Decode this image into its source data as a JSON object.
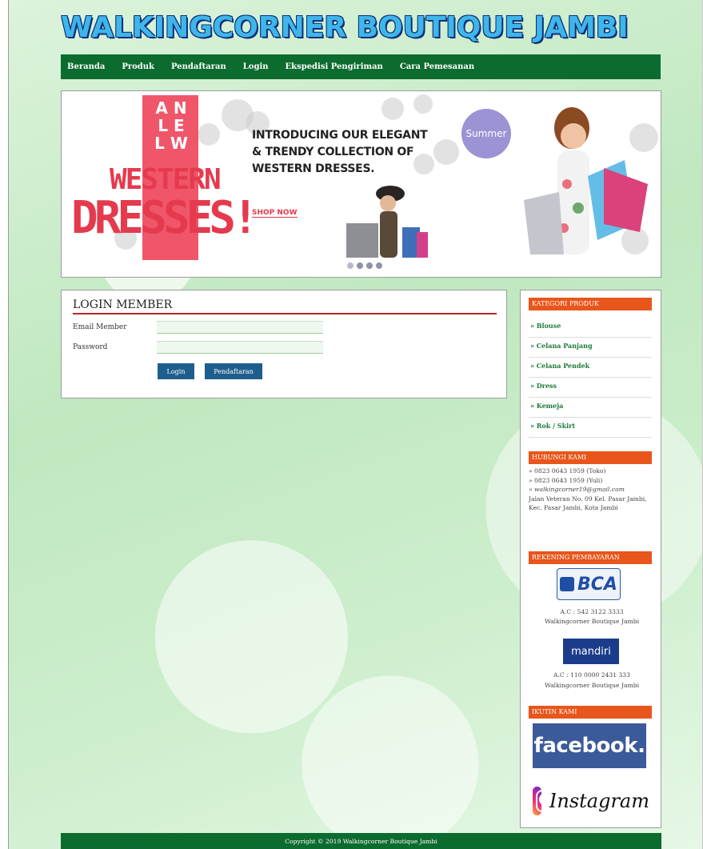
{
  "site": {
    "logo_text": "WALKINGCORNER BOUTIQUE JAMBI"
  },
  "nav": {
    "items": [
      "Beranda",
      "Produk",
      "Pendaftaran",
      "Login",
      "Ekspedisi Pengiriman",
      "Cara Pemesanan"
    ]
  },
  "banner": {
    "all_new": "A N L E L W",
    "western": "WESTERN",
    "dresses": "DRESSES!",
    "intro_line1": "INTRODUCING OUR ELEGANT",
    "intro_line2": "& TRENDY COLLECTION OF",
    "intro_line3": "WESTERN DRESSES.",
    "shop_now": "SHOP NOW",
    "summer": "Summer",
    "slide_count": 4,
    "active_slide": 1
  },
  "login": {
    "title": "LOGIN MEMBER",
    "email_label": "Email Member",
    "password_label": "Password",
    "email_value": "",
    "password_value": "",
    "login_button": "Login",
    "register_button": "Pendaftaran"
  },
  "sidebar": {
    "categories_title": "KATEGORI PRODUK",
    "categories": [
      "» Blouse",
      "» Celana Panjang",
      "» Celana Pendek",
      "» Dress",
      "» Kemeja",
      "» Rok / Skirt"
    ],
    "contact_title": "HUBUNGI KAMI",
    "contact_phone_store": "» 0823 0643 1959 (Toko)",
    "contact_phone_yuli": "» 0823 0643 1959 (Yuli)",
    "contact_email": "» walkingcorner19@gmail.com",
    "contact_address": "Jalan Veteran No. 09 Kel. Pasar Jambi, Kec. Pasar Jambi, Kota Jambi",
    "payment_title": "REKENING PEMBAYARAN",
    "bca_logo_text": "BCA",
    "bca_account": "A.C : 542 3122 3333",
    "bca_holder": "Walkingcorner Boutique Jambi",
    "mandiri_logo_text": "mandiri",
    "mandiri_account": "A.C : 110 0000 2431 333",
    "mandiri_holder": "Walkingcorner Boutique Jambi",
    "follow_title": "IKUTIN KAMI",
    "facebook_text": "facebook.",
    "instagram_text": "Instagram"
  },
  "footer": {
    "copyright": "Copyright © 2019 Walkingcorner Boutique Jambi"
  },
  "colors": {
    "nav_green": "#0c6b2e",
    "accent_orange": "#e8561c",
    "button_blue": "#1e5e8e",
    "login_title_rule": "#b5282a"
  }
}
